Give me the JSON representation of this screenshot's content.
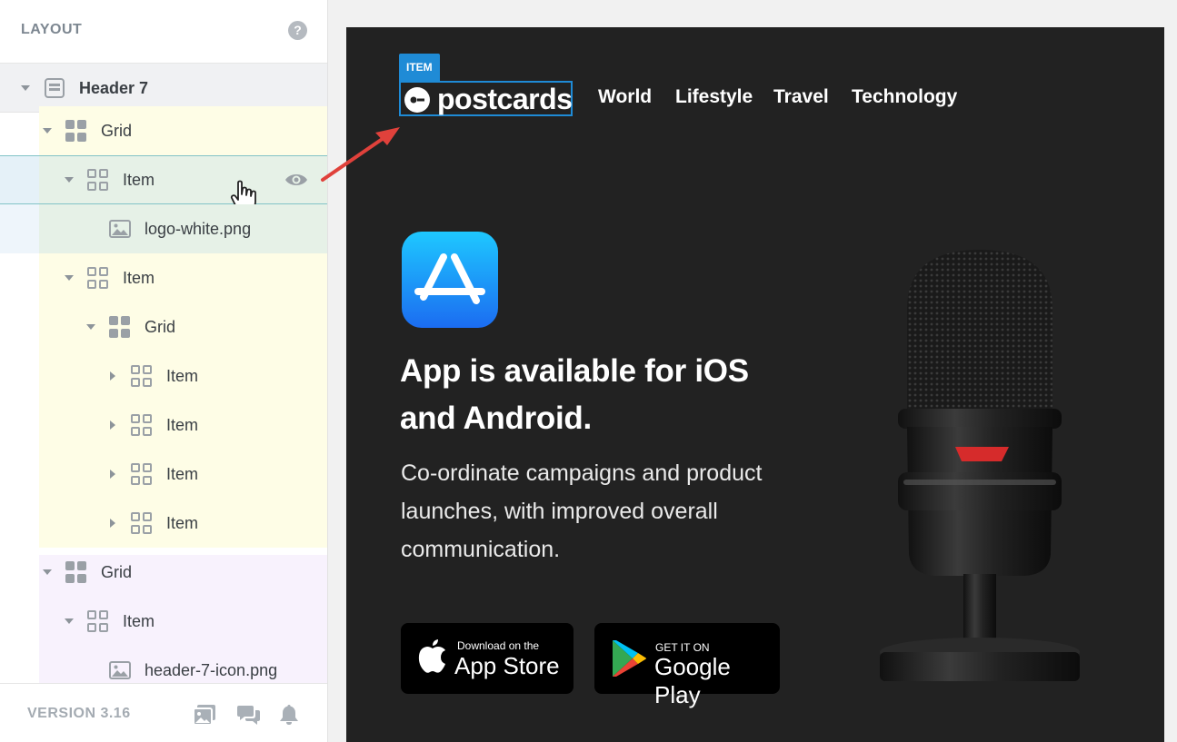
{
  "sidebar": {
    "title": "LAYOUT",
    "help": "?",
    "tree": [
      {
        "label": "Header 7"
      },
      {
        "label": "Grid"
      },
      {
        "label": "Item"
      },
      {
        "label": "logo-white.png"
      },
      {
        "label": "Item"
      },
      {
        "label": "Grid"
      },
      {
        "label": "Item"
      },
      {
        "label": "Item"
      },
      {
        "label": "Item"
      },
      {
        "label": "Item"
      },
      {
        "label": "Grid"
      },
      {
        "label": "Item"
      },
      {
        "label": "header-7-icon.png"
      }
    ],
    "version": "VERSION 3.16"
  },
  "canvas": {
    "item_tag": "ITEM",
    "logo_text": "postcards",
    "nav": [
      "World",
      "Lifestyle",
      "Travel",
      "Technology"
    ],
    "headline": "App is available for iOS and Android.",
    "description": "Co-ordinate campaigns and product launches, with improved overall communication.",
    "appstore": {
      "small": "Download on the",
      "big": "App Store"
    },
    "googleplay": {
      "small": "GET IT ON",
      "big": "Google Play"
    }
  },
  "colors": {
    "accent": "#1f8bd6",
    "canvas_bg": "#222222",
    "row_highlight": "#e5f1f8",
    "grid_yellow": "#fefde6",
    "grid_purple": "#f8f2fd",
    "item_green": "#e6f1e7"
  },
  "icons": [
    "help-icon",
    "header-block-icon",
    "grid-icon",
    "item-icon",
    "image-icon",
    "eye-icon",
    "hand-pointer-icon",
    "images-icon",
    "comments-icon",
    "bell-icon",
    "app-store-icon",
    "apple-icon",
    "google-play-icon",
    "microphone-image",
    "annotation-arrow"
  ]
}
